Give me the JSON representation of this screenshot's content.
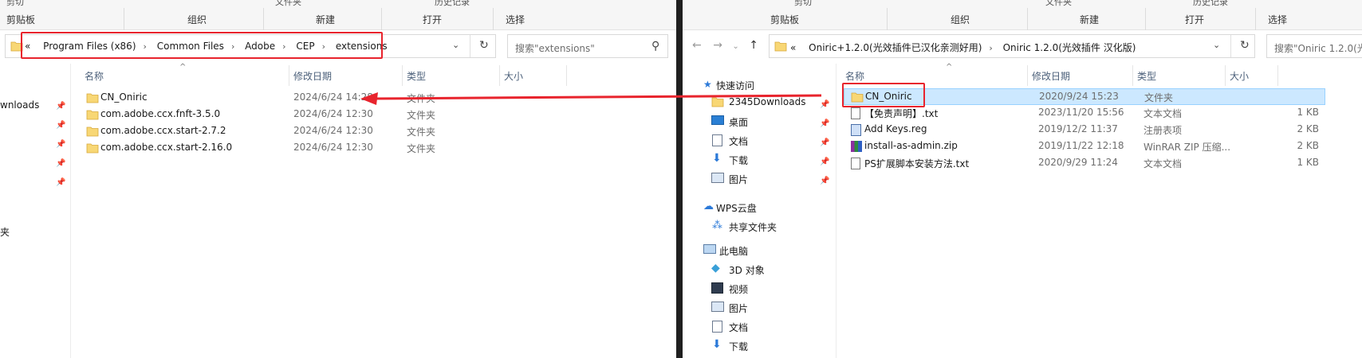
{
  "left": {
    "ribbon_top": [
      "剪切",
      "文件夹",
      "历史记录"
    ],
    "ribbon_groups": [
      "剪贴板",
      "组织",
      "新建",
      "打开",
      "选择"
    ],
    "breadcrumb": [
      "«",
      "Program Files (x86)",
      "Common Files",
      "Adobe",
      "CEP",
      "extensions"
    ],
    "search_placeholder": "搜索\"extensions\"",
    "columns": {
      "name": "名称",
      "date": "修改日期",
      "type": "类型",
      "size": "大小"
    },
    "sidebar": [
      {
        "label": "wnloads",
        "pinned": true
      },
      {
        "label": "",
        "pinned": true
      },
      {
        "label": "",
        "pinned": true
      },
      {
        "label": "",
        "pinned": true
      },
      {
        "label": "",
        "pinned": true
      },
      {
        "label": "夹",
        "pinned": false
      }
    ],
    "files": [
      {
        "name": "CN_Oniric",
        "date": "2024/6/24 14:28",
        "type": "文件夹"
      },
      {
        "name": "com.adobe.ccx.fnft-3.5.0",
        "date": "2024/6/24 12:30",
        "type": "文件夹"
      },
      {
        "name": "com.adobe.ccx.start-2.7.2",
        "date": "2024/6/24 12:30",
        "type": "文件夹"
      },
      {
        "name": "com.adobe.ccx.start-2.16.0",
        "date": "2024/6/24 12:30",
        "type": "文件夹"
      }
    ]
  },
  "right": {
    "ribbon_top": [
      "剪切",
      "文件夹",
      "历史记录"
    ],
    "ribbon_groups": [
      "剪贴板",
      "组织",
      "新建",
      "打开",
      "选择"
    ],
    "breadcrumb": [
      "«",
      "Oniric+1.2.0(光效插件已汉化亲测好用)",
      "Oniric 1.2.0(光效插件 汉化版)"
    ],
    "search_placeholder": "搜索\"Oniric 1.2.0(光",
    "columns": {
      "name": "名称",
      "date": "修改日期",
      "type": "类型",
      "size": "大小"
    },
    "sidebar": [
      {
        "label": "快速访问",
        "icon": "star-icon",
        "level": 0,
        "pinned": false
      },
      {
        "label": "2345Downloads",
        "icon": "folder-icon",
        "level": 1,
        "pinned": true
      },
      {
        "label": "桌面",
        "icon": "desktop-icon",
        "level": 1,
        "pinned": true
      },
      {
        "label": "文档",
        "icon": "document-icon",
        "level": 1,
        "pinned": true
      },
      {
        "label": "下载",
        "icon": "download-icon",
        "level": 1,
        "pinned": true
      },
      {
        "label": "图片",
        "icon": "picture-icon",
        "level": 1,
        "pinned": true
      },
      {
        "label": "WPS云盘",
        "icon": "cloud-icon",
        "level": 0,
        "pinned": false
      },
      {
        "label": "共享文件夹",
        "icon": "share-icon",
        "level": 1,
        "pinned": false
      },
      {
        "label": "此电脑",
        "icon": "computer-icon",
        "level": 0,
        "pinned": false
      },
      {
        "label": "3D 对象",
        "icon": "cube-icon",
        "level": 1,
        "pinned": false
      },
      {
        "label": "视频",
        "icon": "video-icon",
        "level": 1,
        "pinned": false
      },
      {
        "label": "图片",
        "icon": "picture-icon",
        "level": 1,
        "pinned": false
      },
      {
        "label": "文档",
        "icon": "document-icon",
        "level": 1,
        "pinned": false
      },
      {
        "label": "下载",
        "icon": "download-icon",
        "level": 1,
        "pinned": false
      }
    ],
    "files": [
      {
        "name": "CN_Oniric",
        "date": "2020/9/24 15:23",
        "type": "文件夹",
        "size": "",
        "icon": "folder-icon"
      },
      {
        "name": "【免责声明】.txt",
        "date": "2023/11/20 15:56",
        "type": "文本文档",
        "size": "1 KB",
        "icon": "text-file-icon"
      },
      {
        "name": "Add Keys.reg",
        "date": "2019/12/2 11:37",
        "type": "注册表项",
        "size": "2 KB",
        "icon": "registry-file-icon"
      },
      {
        "name": "install-as-admin.zip",
        "date": "2019/11/22 12:18",
        "type": "WinRAR ZIP 压缩...",
        "size": "2 KB",
        "icon": "zip-file-icon"
      },
      {
        "name": "PS扩展脚本安装方法.txt",
        "date": "2020/9/29 11:24",
        "type": "文本文档",
        "size": "1 KB",
        "icon": "text-file-icon"
      }
    ]
  },
  "colors": {
    "highlight": "#e8242d",
    "selection": "#cce8ff",
    "folder": "#f8d775"
  }
}
